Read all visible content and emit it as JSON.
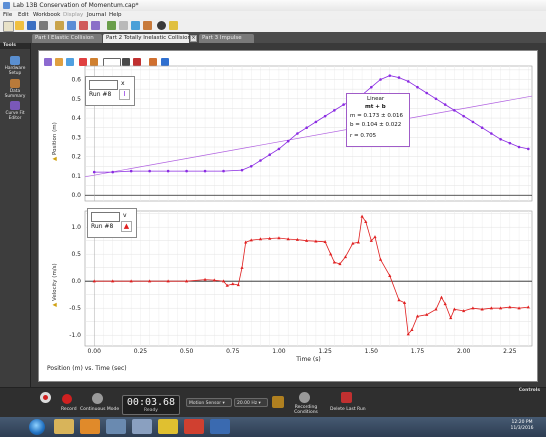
{
  "window": {
    "title": "Lab 13B Conservation of Momentum.cap*"
  },
  "menu": {
    "file": "File",
    "edit": "Edit",
    "workbook": "Workbook",
    "display": "Display",
    "journal": "Journal",
    "help": "Help"
  },
  "tabs": [
    {
      "label": "Part I Elastic Collision"
    },
    {
      "label": "Part 2 Totally Inelastic Collision"
    },
    {
      "label": "Part 3 Impulse"
    }
  ],
  "sidebar": {
    "header": "Tools",
    "items": [
      {
        "label": "Hardware Setup",
        "icon": "hardware-setup-icon",
        "color": "#5a8fd0"
      },
      {
        "label": "Data Summary",
        "icon": "data-summary-icon",
        "color": "#b87a3a"
      },
      {
        "label": "Curve Fit Editor",
        "icon": "curve-fit-icon",
        "color": "#7a58b8"
      }
    ]
  },
  "graph1": {
    "legend_axis": "x",
    "run": "Run #8",
    "ylabel": "Position (m)",
    "ticks": [
      "0.6",
      "0.5",
      "0.4",
      "0.3",
      "0.2",
      "0.1",
      "0.0"
    ]
  },
  "fit": {
    "title": "Linear",
    "eq": "mt + b",
    "m": "m = 0.173 ± 0.016",
    "b": "b = 0.104 ± 0.022",
    "r": "r = 0.705"
  },
  "graph2": {
    "legend_axis": "v",
    "run": "Run #8",
    "ylabel": "Velocity (m/s)",
    "ticks": [
      "1.0",
      "0.5",
      "0.0",
      "-0.5",
      "-1.0"
    ]
  },
  "xaxis": {
    "label": "Time (s)",
    "ticks": [
      "0.00",
      "0.25",
      "0.50",
      "0.75",
      "1.00",
      "1.25",
      "1.50",
      "1.75",
      "2.00",
      "2.25"
    ]
  },
  "footnote": "Position (m) vs. Time (sec)",
  "controls": {
    "header": "Controls",
    "record": "Record",
    "mode": "Continuous Mode",
    "timer": "00:03.68",
    "status": "Ready",
    "sensor": "Motion Sensor",
    "rate": "20.00 Hz",
    "recording": "Recording Conditions",
    "delete": "Delete Last Run"
  },
  "clock": {
    "time": "12:20 PM",
    "date": "11/3/2016"
  },
  "colors": {
    "position": "#8a2be2",
    "velocity": "#e02020",
    "fit": "#b060e0"
  },
  "chart_data": [
    {
      "type": "line",
      "title": "",
      "xlabel": "Time (s)",
      "ylabel": "Position (m)",
      "xlim": [
        -0.05,
        2.37
      ],
      "ylim": [
        -0.03,
        0.67
      ],
      "series": [
        {
          "name": "Run #8",
          "x": [
            0.0,
            0.1,
            0.2,
            0.3,
            0.4,
            0.5,
            0.6,
            0.7,
            0.8,
            0.85,
            0.9,
            0.95,
            1.0,
            1.05,
            1.1,
            1.15,
            1.2,
            1.25,
            1.3,
            1.35,
            1.4,
            1.45,
            1.5,
            1.55,
            1.6,
            1.65,
            1.7,
            1.75,
            1.8,
            1.85,
            1.9,
            1.95,
            2.0,
            2.05,
            2.1,
            2.15,
            2.2,
            2.25,
            2.3,
            2.35
          ],
          "y": [
            0.12,
            0.12,
            0.125,
            0.125,
            0.125,
            0.125,
            0.125,
            0.125,
            0.13,
            0.15,
            0.18,
            0.21,
            0.24,
            0.28,
            0.32,
            0.35,
            0.38,
            0.41,
            0.44,
            0.47,
            0.49,
            0.52,
            0.56,
            0.6,
            0.62,
            0.61,
            0.59,
            0.56,
            0.53,
            0.5,
            0.47,
            0.44,
            0.41,
            0.38,
            0.35,
            0.32,
            0.29,
            0.27,
            0.25,
            0.24
          ]
        }
      ],
      "fit": {
        "m": 0.173,
        "b": 0.104
      }
    },
    {
      "type": "line",
      "title": "",
      "xlabel": "Time (s)",
      "ylabel": "Velocity (m/s)",
      "xlim": [
        -0.05,
        2.37
      ],
      "ylim": [
        -1.2,
        1.3
      ],
      "series": [
        {
          "name": "Run #8",
          "x": [
            0.0,
            0.1,
            0.2,
            0.3,
            0.4,
            0.5,
            0.6,
            0.65,
            0.7,
            0.72,
            0.75,
            0.78,
            0.8,
            0.82,
            0.85,
            0.9,
            0.95,
            1.0,
            1.05,
            1.1,
            1.15,
            1.2,
            1.25,
            1.28,
            1.3,
            1.33,
            1.36,
            1.4,
            1.43,
            1.45,
            1.47,
            1.5,
            1.52,
            1.55,
            1.6,
            1.65,
            1.68,
            1.7,
            1.72,
            1.75,
            1.8,
            1.85,
            1.88,
            1.9,
            1.93,
            1.95,
            2.0,
            2.05,
            2.1,
            2.15,
            2.2,
            2.25,
            2.3,
            2.35
          ],
          "y": [
            0.0,
            0.0,
            0.0,
            0.0,
            0.0,
            0.0,
            0.03,
            0.02,
            0.0,
            -0.08,
            -0.05,
            -0.07,
            0.25,
            0.72,
            0.76,
            0.78,
            0.79,
            0.8,
            0.78,
            0.77,
            0.75,
            0.74,
            0.73,
            0.5,
            0.35,
            0.32,
            0.45,
            0.7,
            0.72,
            1.2,
            1.1,
            0.75,
            0.82,
            0.4,
            0.1,
            -0.35,
            -0.4,
            -0.98,
            -0.9,
            -0.65,
            -0.62,
            -0.52,
            -0.3,
            -0.42,
            -0.68,
            -0.52,
            -0.55,
            -0.5,
            -0.52,
            -0.5,
            -0.5,
            -0.48,
            -0.5,
            -0.48
          ]
        }
      ]
    }
  ]
}
